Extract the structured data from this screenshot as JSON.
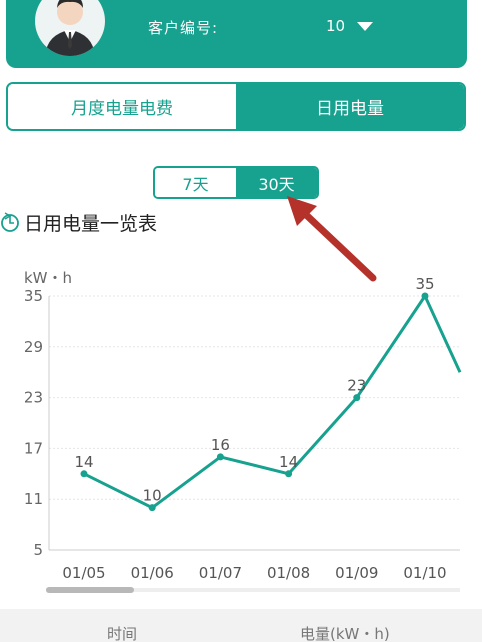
{
  "header": {
    "account_label": "客户编号:",
    "account_value": "10",
    "avatar_icon": "user-avatar-icon",
    "caret_icon": "caret-down-icon"
  },
  "main_tabs": [
    {
      "label": "月度电量电费",
      "active": false
    },
    {
      "label": "日用电量",
      "active": true
    }
  ],
  "range_tabs": [
    {
      "label": "7天",
      "active": false
    },
    {
      "label": "30天",
      "active": true
    }
  ],
  "section": {
    "title": "日用电量一览表",
    "icon": "clock-24-icon"
  },
  "colors": {
    "accent": "#17a18f",
    "arrow": "#b5322b"
  },
  "chart_data": {
    "type": "line",
    "ylabel": "kW・h",
    "ylim": [
      5,
      35
    ],
    "yticks": [
      "5",
      "11",
      "17",
      "23",
      "29",
      "35"
    ],
    "categories": [
      "01/05",
      "01/06",
      "01/07",
      "01/08",
      "01/09",
      "01/10"
    ],
    "values": [
      14,
      10,
      16,
      14,
      23,
      35
    ],
    "data_labels": [
      "14",
      "10",
      "16",
      "14",
      "23",
      "35"
    ],
    "continuation_value": 26,
    "grid": true
  },
  "table": {
    "columns": [
      "时间",
      "电量(kW・h)"
    ]
  }
}
